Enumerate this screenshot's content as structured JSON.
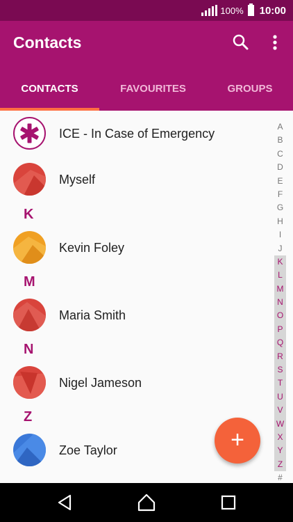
{
  "status": {
    "battery": "100%",
    "time": "10:00"
  },
  "app": {
    "title": "Contacts"
  },
  "tabs": [
    {
      "label": "CONTACTS"
    },
    {
      "label": "FAVOURITES"
    },
    {
      "label": "GROUPS"
    }
  ],
  "contacts": [
    {
      "name": "ICE - In Case of Emergency"
    },
    {
      "name": "Myself"
    },
    {
      "section": "K",
      "name": "Kevin Foley"
    },
    {
      "section": "M",
      "name": "Maria Smith"
    },
    {
      "section": "N",
      "name": "Nigel Jameson"
    },
    {
      "section": "Z",
      "name": "Zoe Taylor"
    }
  ],
  "alphabet": [
    "A",
    "B",
    "C",
    "D",
    "E",
    "F",
    "G",
    "H",
    "I",
    "J",
    "K",
    "L",
    "M",
    "N",
    "O",
    "P",
    "Q",
    "R",
    "S",
    "T",
    "U",
    "V",
    "W",
    "X",
    "Y",
    "Z",
    "#"
  ],
  "fab": {
    "symbol": "+"
  },
  "colors": {
    "accent": "#a6136f",
    "status_bar": "#7a0a52",
    "fab": "#f4623a",
    "tab_indicator": "#ff7043"
  }
}
